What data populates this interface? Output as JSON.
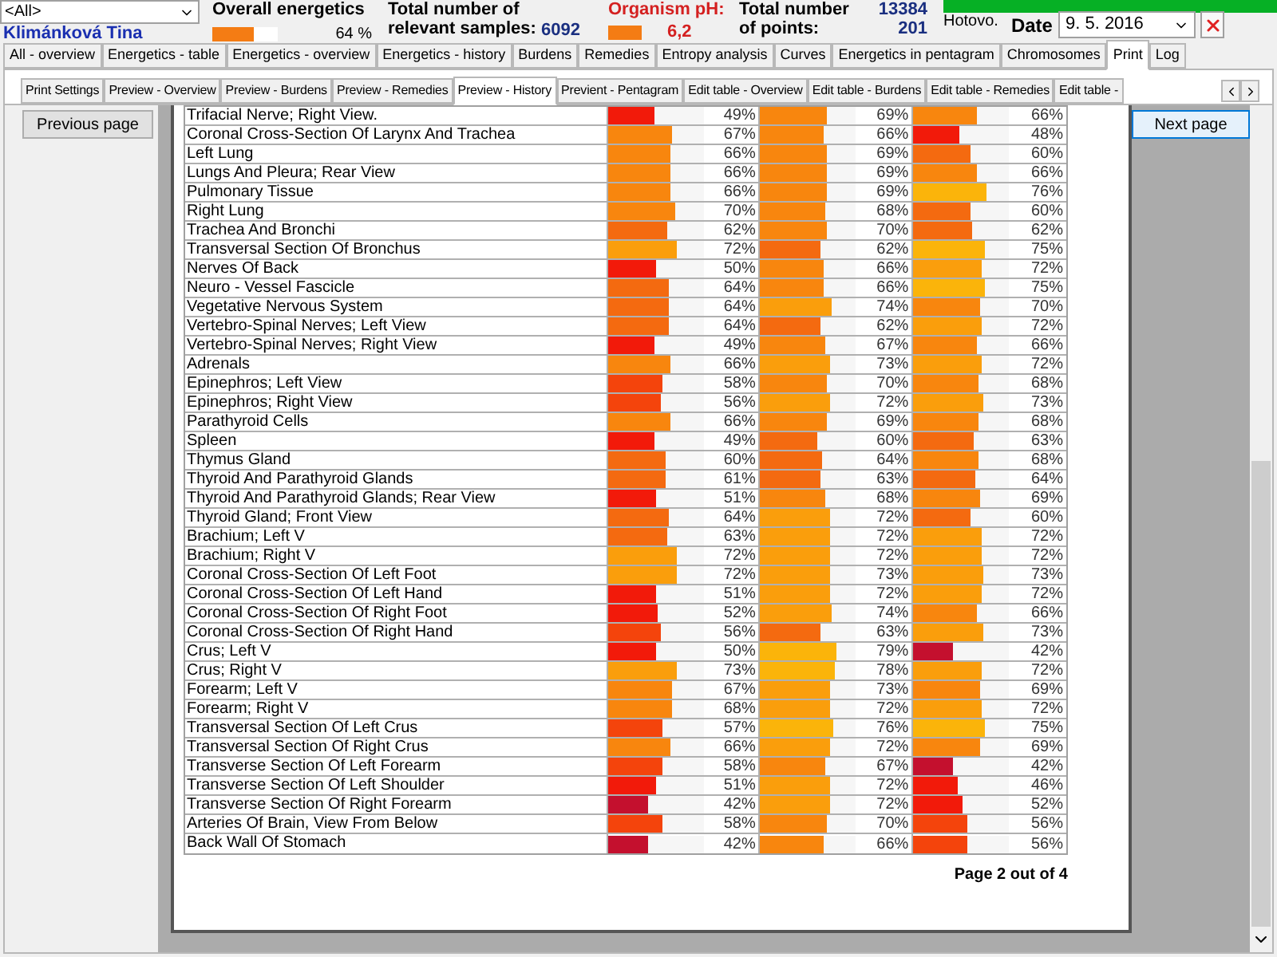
{
  "header": {
    "patient_select": {
      "value": "<All>"
    },
    "patient_name": "Klimánková Tina",
    "overall": {
      "label": "Overall energetics",
      "level": 0.64,
      "reading": "64 %"
    },
    "samples": {
      "label": "Total number of relevant samples:",
      "value": "6092"
    },
    "ph": {
      "label": "Organism pH:",
      "value": "6,2"
    },
    "points": {
      "label": "Total number of points:",
      "values": [
        "13384",
        "201"
      ]
    },
    "progress": {
      "level": 1
    },
    "status": "Hotovo.",
    "date": {
      "label": "Date",
      "value": "9. 5. 2016"
    }
  },
  "main_tabs": [
    {
      "label": "All - overview",
      "selected": false
    },
    {
      "label": "Energetics - table",
      "selected": false
    },
    {
      "label": "Energetics - overview",
      "selected": false
    },
    {
      "label": "Energetics - history",
      "selected": false
    },
    {
      "label": "Burdens",
      "selected": false
    },
    {
      "label": "Remedies",
      "selected": false
    },
    {
      "label": "Entropy analysis",
      "selected": false
    },
    {
      "label": "Curves",
      "selected": false
    },
    {
      "label": "Energetics in pentagram",
      "selected": false
    },
    {
      "label": "Chromosomes",
      "selected": false
    },
    {
      "label": "Print",
      "selected": true
    },
    {
      "label": "Log",
      "selected": false
    }
  ],
  "sub_tabs": [
    {
      "label": "Print Settings",
      "selected": false
    },
    {
      "label": "Preview - Overview",
      "selected": false
    },
    {
      "label": "Preview - Burdens",
      "selected": false
    },
    {
      "label": "Preview - Remedies",
      "selected": false
    },
    {
      "label": "Preview - History",
      "selected": true
    },
    {
      "label": "Previent - Pentagram",
      "selected": false
    },
    {
      "label": "Edit table - Overview",
      "selected": false
    },
    {
      "label": "Edit table - Burdens",
      "selected": false
    },
    {
      "label": "Edit table - Remedies",
      "selected": false
    },
    {
      "label": "Edit table -",
      "selected": false
    }
  ],
  "buttons": {
    "previous": "Previous page",
    "next": "Next page"
  },
  "rows": [
    {
      "name": "Trifacial Nerve; Right View.",
      "cells": [
        {
          "level": 0.49,
          "reading": "49%"
        },
        {
          "level": 0.69,
          "reading": "69%"
        },
        {
          "level": 0.66,
          "reading": "66%"
        }
      ]
    },
    {
      "name": "Coronal Cross-Section Of Larynx And Trachea",
      "cells": [
        {
          "level": 0.67,
          "reading": "67%"
        },
        {
          "level": 0.66,
          "reading": "66%"
        },
        {
          "level": 0.48,
          "reading": "48%"
        }
      ]
    },
    {
      "name": "Left Lung",
      "cells": [
        {
          "level": 0.66,
          "reading": "66%"
        },
        {
          "level": 0.69,
          "reading": "69%"
        },
        {
          "level": 0.6,
          "reading": "60%"
        }
      ]
    },
    {
      "name": "Lungs And Pleura; Rear View",
      "cells": [
        {
          "level": 0.66,
          "reading": "66%"
        },
        {
          "level": 0.69,
          "reading": "69%"
        },
        {
          "level": 0.66,
          "reading": "66%"
        }
      ]
    },
    {
      "name": "Pulmonary Tissue",
      "cells": [
        {
          "level": 0.66,
          "reading": "66%"
        },
        {
          "level": 0.69,
          "reading": "69%"
        },
        {
          "level": 0.76,
          "reading": "76%"
        }
      ]
    },
    {
      "name": "Right Lung",
      "cells": [
        {
          "level": 0.7,
          "reading": "70%"
        },
        {
          "level": 0.68,
          "reading": "68%"
        },
        {
          "level": 0.6,
          "reading": "60%"
        }
      ]
    },
    {
      "name": "Trachea And Bronchi",
      "cells": [
        {
          "level": 0.62,
          "reading": "62%"
        },
        {
          "level": 0.7,
          "reading": "70%"
        },
        {
          "level": 0.62,
          "reading": "62%"
        }
      ]
    },
    {
      "name": "Transversal Section Of Bronchus",
      "cells": [
        {
          "level": 0.72,
          "reading": "72%"
        },
        {
          "level": 0.62,
          "reading": "62%"
        },
        {
          "level": 0.75,
          "reading": "75%"
        }
      ]
    },
    {
      "name": "Nerves Of Back",
      "cells": [
        {
          "level": 0.5,
          "reading": "50%"
        },
        {
          "level": 0.66,
          "reading": "66%"
        },
        {
          "level": 0.72,
          "reading": "72%"
        }
      ]
    },
    {
      "name": "Neuro - Vessel Fascicle",
      "cells": [
        {
          "level": 0.64,
          "reading": "64%"
        },
        {
          "level": 0.66,
          "reading": "66%"
        },
        {
          "level": 0.75,
          "reading": "75%"
        }
      ]
    },
    {
      "name": "Vegetative Nervous System",
      "cells": [
        {
          "level": 0.64,
          "reading": "64%"
        },
        {
          "level": 0.74,
          "reading": "74%"
        },
        {
          "level": 0.7,
          "reading": "70%"
        }
      ]
    },
    {
      "name": "Vertebro-Spinal Nerves; Left View",
      "cells": [
        {
          "level": 0.64,
          "reading": "64%"
        },
        {
          "level": 0.62,
          "reading": "62%"
        },
        {
          "level": 0.72,
          "reading": "72%"
        }
      ]
    },
    {
      "name": "Vertebro-Spinal Nerves; Right View",
      "cells": [
        {
          "level": 0.49,
          "reading": "49%"
        },
        {
          "level": 0.67,
          "reading": "67%"
        },
        {
          "level": 0.66,
          "reading": "66%"
        }
      ]
    },
    {
      "name": "Adrenals",
      "cells": [
        {
          "level": 0.66,
          "reading": "66%"
        },
        {
          "level": 0.73,
          "reading": "73%"
        },
        {
          "level": 0.72,
          "reading": "72%"
        }
      ]
    },
    {
      "name": "Epinephros; Left View",
      "cells": [
        {
          "level": 0.58,
          "reading": "58%"
        },
        {
          "level": 0.7,
          "reading": "70%"
        },
        {
          "level": 0.68,
          "reading": "68%"
        }
      ]
    },
    {
      "name": "Epinephros; Right View",
      "cells": [
        {
          "level": 0.56,
          "reading": "56%"
        },
        {
          "level": 0.72,
          "reading": "72%"
        },
        {
          "level": 0.73,
          "reading": "73%"
        }
      ]
    },
    {
      "name": "Parathyroid Cells",
      "cells": [
        {
          "level": 0.66,
          "reading": "66%"
        },
        {
          "level": 0.69,
          "reading": "69%"
        },
        {
          "level": 0.68,
          "reading": "68%"
        }
      ]
    },
    {
      "name": "Spleen",
      "cells": [
        {
          "level": 0.49,
          "reading": "49%"
        },
        {
          "level": 0.6,
          "reading": "60%"
        },
        {
          "level": 0.63,
          "reading": "63%"
        }
      ]
    },
    {
      "name": "Thymus Gland",
      "cells": [
        {
          "level": 0.6,
          "reading": "60%"
        },
        {
          "level": 0.64,
          "reading": "64%"
        },
        {
          "level": 0.68,
          "reading": "68%"
        }
      ]
    },
    {
      "name": "Thyroid And Parathyroid Glands",
      "cells": [
        {
          "level": 0.61,
          "reading": "61%"
        },
        {
          "level": 0.63,
          "reading": "63%"
        },
        {
          "level": 0.64,
          "reading": "64%"
        }
      ]
    },
    {
      "name": "Thyroid And Parathyroid Glands; Rear View",
      "cells": [
        {
          "level": 0.51,
          "reading": "51%"
        },
        {
          "level": 0.68,
          "reading": "68%"
        },
        {
          "level": 0.69,
          "reading": "69%"
        }
      ]
    },
    {
      "name": "Thyroid Gland; Front View",
      "cells": [
        {
          "level": 0.64,
          "reading": "64%"
        },
        {
          "level": 0.72,
          "reading": "72%"
        },
        {
          "level": 0.6,
          "reading": "60%"
        }
      ]
    },
    {
      "name": "Brachium; Left V",
      "cells": [
        {
          "level": 0.63,
          "reading": "63%"
        },
        {
          "level": 0.72,
          "reading": "72%"
        },
        {
          "level": 0.72,
          "reading": "72%"
        }
      ]
    },
    {
      "name": "Brachium; Right V",
      "cells": [
        {
          "level": 0.72,
          "reading": "72%"
        },
        {
          "level": 0.72,
          "reading": "72%"
        },
        {
          "level": 0.72,
          "reading": "72%"
        }
      ]
    },
    {
      "name": "Coronal Cross-Section Of Left Foot",
      "cells": [
        {
          "level": 0.72,
          "reading": "72%"
        },
        {
          "level": 0.73,
          "reading": "73%"
        },
        {
          "level": 0.73,
          "reading": "73%"
        }
      ]
    },
    {
      "name": "Coronal Cross-Section Of Left Hand",
      "cells": [
        {
          "level": 0.51,
          "reading": "51%"
        },
        {
          "level": 0.72,
          "reading": "72%"
        },
        {
          "level": 0.72,
          "reading": "72%"
        }
      ]
    },
    {
      "name": "Coronal Cross-Section Of Right Foot",
      "cells": [
        {
          "level": 0.52,
          "reading": "52%"
        },
        {
          "level": 0.74,
          "reading": "74%"
        },
        {
          "level": 0.66,
          "reading": "66%"
        }
      ]
    },
    {
      "name": "Coronal Cross-Section Of Right Hand",
      "cells": [
        {
          "level": 0.56,
          "reading": "56%"
        },
        {
          "level": 0.63,
          "reading": "63%"
        },
        {
          "level": 0.73,
          "reading": "73%"
        }
      ]
    },
    {
      "name": "Crus; Left V",
      "cells": [
        {
          "level": 0.5,
          "reading": "50%"
        },
        {
          "level": 0.79,
          "reading": "79%"
        },
        {
          "level": 0.42,
          "reading": "42%"
        }
      ]
    },
    {
      "name": "Crus; Right V",
      "cells": [
        {
          "level": 0.73,
          "reading": "73%"
        },
        {
          "level": 0.78,
          "reading": "78%"
        },
        {
          "level": 0.72,
          "reading": "72%"
        }
      ]
    },
    {
      "name": "Forearm; Left V",
      "cells": [
        {
          "level": 0.67,
          "reading": "67%"
        },
        {
          "level": 0.73,
          "reading": "73%"
        },
        {
          "level": 0.69,
          "reading": "69%"
        }
      ]
    },
    {
      "name": "Forearm; Right V",
      "cells": [
        {
          "level": 0.68,
          "reading": "68%"
        },
        {
          "level": 0.72,
          "reading": "72%"
        },
        {
          "level": 0.72,
          "reading": "72%"
        }
      ]
    },
    {
      "name": "Transversal Section Of Left Crus",
      "cells": [
        {
          "level": 0.57,
          "reading": "57%"
        },
        {
          "level": 0.76,
          "reading": "76%"
        },
        {
          "level": 0.75,
          "reading": "75%"
        }
      ]
    },
    {
      "name": "Transversal Section Of Right Crus",
      "cells": [
        {
          "level": 0.66,
          "reading": "66%"
        },
        {
          "level": 0.72,
          "reading": "72%"
        },
        {
          "level": 0.69,
          "reading": "69%"
        }
      ]
    },
    {
      "name": "Transverse Section Of Left Forearm",
      "cells": [
        {
          "level": 0.58,
          "reading": "58%"
        },
        {
          "level": 0.67,
          "reading": "67%"
        },
        {
          "level": 0.42,
          "reading": "42%"
        }
      ]
    },
    {
      "name": "Transverse Section Of Left Shoulder",
      "cells": [
        {
          "level": 0.51,
          "reading": "51%"
        },
        {
          "level": 0.72,
          "reading": "72%"
        },
        {
          "level": 0.46,
          "reading": "46%"
        }
      ]
    },
    {
      "name": "Transverse Section Of Right Forearm",
      "cells": [
        {
          "level": 0.42,
          "reading": "42%"
        },
        {
          "level": 0.72,
          "reading": "72%"
        },
        {
          "level": 0.52,
          "reading": "52%"
        }
      ]
    },
    {
      "name": "Arteries Of Brain, View From Below",
      "cells": [
        {
          "level": 0.58,
          "reading": "58%"
        },
        {
          "level": 0.7,
          "reading": "70%"
        },
        {
          "level": 0.56,
          "reading": "56%"
        }
      ]
    },
    {
      "name": "Back Wall Of Stomach",
      "cells": [
        {
          "level": 0.42,
          "reading": "42%"
        },
        {
          "level": 0.66,
          "reading": "66%"
        },
        {
          "level": 0.56,
          "reading": "56%"
        }
      ]
    }
  ],
  "page_label": "Page 2 out of 4"
}
